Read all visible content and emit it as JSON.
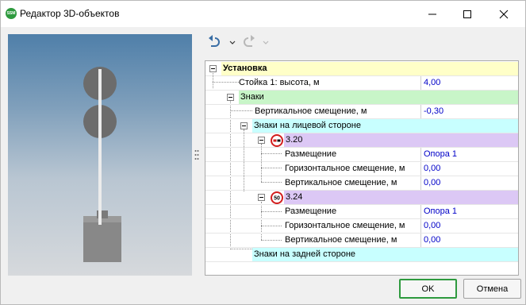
{
  "window": {
    "title": "Редактор 3D-объектов",
    "app_icon_text": "SSM",
    "accent_color": "#2e9a3e"
  },
  "toolbar": {
    "undo_icon": "undo-icon",
    "redo_icon": "redo-icon"
  },
  "tree": {
    "rows": [
      {
        "label": "Установка",
        "value": "",
        "bg": "#ffffc8",
        "bold": true
      },
      {
        "label": "Стойка 1: высота, м",
        "value": "4,00",
        "bg": "#ffffff"
      },
      {
        "label": "Знаки",
        "value": "",
        "bg": "#c8f5c8"
      },
      {
        "label": "Вертикальное смещение, м",
        "value": "-0,30",
        "bg": "#ffffff"
      },
      {
        "label": "Знаки на лицевой стороне",
        "value": "",
        "bg": "#c8ffff"
      },
      {
        "label": "3.20",
        "value": "",
        "bg": "#dcc8f5",
        "sign": "no-overtaking"
      },
      {
        "label": "Размещение",
        "value": "Опора 1",
        "bg": "#ffffff"
      },
      {
        "label": "Горизонтальное смещение, м",
        "value": "0,00",
        "bg": "#ffffff"
      },
      {
        "label": "Вертикальное смещение, м",
        "value": "0,00",
        "bg": "#ffffff"
      },
      {
        "label": "3.24",
        "value": "",
        "bg": "#dcc8f5",
        "sign": "speed-limit",
        "sign_text": "50"
      },
      {
        "label": "Размещение",
        "value": "Опора 1",
        "bg": "#ffffff"
      },
      {
        "label": "Горизонтальное смещение, м",
        "value": "0,00",
        "bg": "#ffffff"
      },
      {
        "label": "Вертикальное смещение, м",
        "value": "0,00",
        "bg": "#ffffff"
      },
      {
        "label": "Знаки на задней стороне",
        "value": "",
        "bg": "#c8ffff"
      }
    ]
  },
  "buttons": {
    "ok": "OK",
    "cancel": "Отмена"
  }
}
